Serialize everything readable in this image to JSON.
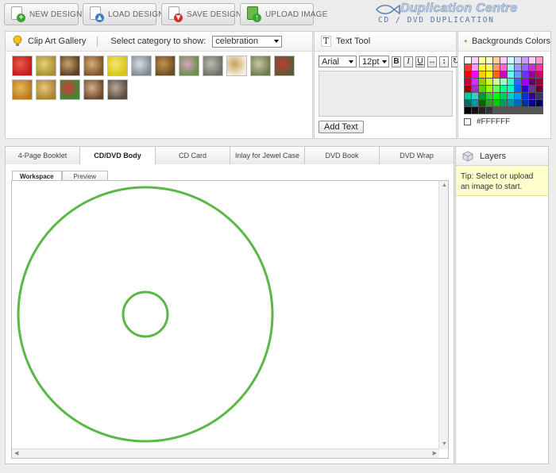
{
  "toolbar": {
    "buttons": [
      {
        "label": "NEW DESIGN",
        "icon": "new-design-icon",
        "accent": "#3aa535"
      },
      {
        "label": "LOAD DESIGN",
        "icon": "load-design-icon",
        "accent": "#3d7fc9"
      },
      {
        "label": "SAVE DESIGN",
        "icon": "save-design-icon",
        "accent": "#d2312a"
      },
      {
        "label": "UPLOAD IMAGE",
        "icon": "upload-image-icon",
        "accent": "#3aa535"
      }
    ]
  },
  "brand": {
    "title": "Duplication Centre",
    "subtitle": "CD / DVD DUPLICATION"
  },
  "clipart": {
    "title": "Clip Art Gallery",
    "category_label": "Select category to show:",
    "category_value": "celebration",
    "thumbnails": [
      {
        "colors": [
          "#c21b1b",
          "#e85a4a"
        ]
      },
      {
        "colors": [
          "#a8902e",
          "#e3d07a"
        ]
      },
      {
        "colors": [
          "#5a3d24",
          "#c9a46a"
        ]
      },
      {
        "colors": [
          "#7a5228",
          "#d8b079"
        ]
      },
      {
        "colors": [
          "#d8c21a",
          "#f5e86a"
        ]
      },
      {
        "colors": [
          "#7e8894",
          "#d9dee4"
        ]
      },
      {
        "colors": [
          "#6d4b22",
          "#c09350"
        ]
      },
      {
        "colors": [
          "#6b8d4e",
          "#d9a3b7"
        ]
      },
      {
        "colors": [
          "#6e7066",
          "#b9bcb0"
        ]
      },
      {
        "colors": [
          "#f4efe1",
          "#c9a25a"
        ]
      },
      {
        "colors": [
          "#6e7a4e",
          "#c8c6a4"
        ]
      },
      {
        "colors": [
          "#5a5a3a",
          "#b84030"
        ]
      },
      {
        "colors": [
          "#b57a1d",
          "#e8b858"
        ]
      },
      {
        "colors": [
          "#a88230",
          "#e6c878"
        ]
      },
      {
        "colors": [
          "#3b8c33",
          "#d23a3a"
        ]
      },
      {
        "colors": [
          "#6b4828",
          "#d7b08a"
        ]
      },
      {
        "colors": [
          "#5a4b40",
          "#b8a89a"
        ]
      }
    ]
  },
  "text_tool": {
    "title": "Text Tool",
    "font": "Arial",
    "size": "12pt",
    "bold": "B",
    "italic": "I",
    "underline": "U",
    "add_button": "Add Text"
  },
  "backgrounds": {
    "title": "Backgrounds Colors",
    "current_hex": "#FFFFFF",
    "palette": [
      "#ffffff",
      "#ffccff",
      "#ffff99",
      "#ffffcc",
      "#ffcc99",
      "#ffccff",
      "#ccffff",
      "#ccccff",
      "#cc99ff",
      "#ffccff",
      "#ff99cc",
      "#ff3333",
      "#ff99ff",
      "#ffff33",
      "#ffff66",
      "#ff9966",
      "#ff66cc",
      "#99ffff",
      "#9999ff",
      "#9966ff",
      "#cc33cc",
      "#ff3399",
      "#ff0000",
      "#ff00ff",
      "#ffcc00",
      "#ffff00",
      "#ff6600",
      "#cc00cc",
      "#66ffff",
      "#6699ff",
      "#6633ff",
      "#990099",
      "#cc0066",
      "#cc0033",
      "#cc33ff",
      "#99cc00",
      "#ccff33",
      "#ccff99",
      "#99ffcc",
      "#33ffcc",
      "#3366ff",
      "#9900ff",
      "#660066",
      "#990033",
      "#990000",
      "#9933cc",
      "#66cc00",
      "#99ff00",
      "#66ff66",
      "#00ff99",
      "#00ffcc",
      "#0066ff",
      "#3300cc",
      "#663399",
      "#660033",
      "#00cc99",
      "#33cccc",
      "#009933",
      "#33cc33",
      "#00ff00",
      "#00cc66",
      "#00cccc",
      "#0099ff",
      "#0033cc",
      "#330099",
      "#333366",
      "#006666",
      "#009999",
      "#006600",
      "#339933",
      "#00cc00",
      "#009966",
      "#009999",
      "#0066cc",
      "#003399",
      "#000099",
      "#000066",
      "#000000",
      "#111111",
      "#222222",
      "#333333"
    ]
  },
  "workspace": {
    "tabs": [
      "4-Page Booklet",
      "CD/DVD Body",
      "CD Card",
      "Inlay for Jewel Case",
      "DVD Book",
      "DVD Wrap"
    ],
    "active_tab": "CD/DVD Body",
    "subtabs": [
      "Workspace",
      "Preview"
    ],
    "active_subtab": "Workspace",
    "disc_color": "#5ab846"
  },
  "layers": {
    "title": "Layers",
    "tip": "Tip: Select or upload an image to start."
  }
}
